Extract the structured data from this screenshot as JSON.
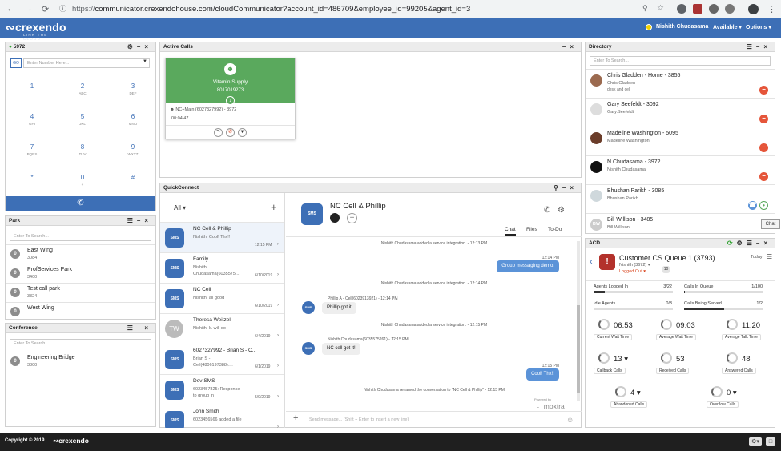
{
  "browser": {
    "url_scheme": "https://",
    "url": "communicator.crexendohouse.com/cloudCommunicator?account_id=486709&employee_id=99205&agent_id=3",
    "nav": [
      "←",
      "→",
      "⟳"
    ]
  },
  "header": {
    "logo": "crexendo",
    "logo_tagline": "LINK THE CLOUD",
    "user": "Nishith Chudasama",
    "availability": "Available ▾",
    "options": "Options ▾"
  },
  "dialer": {
    "title": "5972",
    "go_label": "GO",
    "input_placeholder": "Enter Number Here...",
    "keys": [
      {
        "d": "1",
        "l": ""
      },
      {
        "d": "2",
        "l": "ABC"
      },
      {
        "d": "3",
        "l": "DEF"
      },
      {
        "d": "4",
        "l": "GHI"
      },
      {
        "d": "5",
        "l": "JKL"
      },
      {
        "d": "6",
        "l": "MNO"
      },
      {
        "d": "7",
        "l": "PQRS"
      },
      {
        "d": "8",
        "l": "TUV"
      },
      {
        "d": "9",
        "l": "WXYZ"
      },
      {
        "d": "*",
        "l": ""
      },
      {
        "d": "0",
        "l": "+"
      },
      {
        "d": "#",
        "l": ""
      }
    ]
  },
  "park": {
    "title": "Park",
    "search_placeholder": "Enter To Search...",
    "items": [
      {
        "name": "East Wing",
        "num": "3084"
      },
      {
        "name": "ProfServices Park",
        "num": "3400"
      },
      {
        "name": "Test call park",
        "num": "3324"
      },
      {
        "name": "West Wing",
        "num": ""
      }
    ]
  },
  "conference": {
    "title": "Conference",
    "search_placeholder": "Enter To Search...",
    "items": [
      {
        "name": "Engineering Bridge",
        "num": "3800"
      }
    ]
  },
  "active_calls": {
    "title": "Active Calls",
    "card": {
      "name": "Vitamin Supply",
      "number": "8017019273",
      "line": "NC+Main (6027327992) - 3972",
      "duration": "00:04:47"
    }
  },
  "quickconnect": {
    "title": "QuickConnect",
    "filter": "All",
    "conversations": [
      {
        "name": "NC Cell & Phillip",
        "preview": "Nishith: Cool! Thx!!",
        "date": "12:15 PM"
      },
      {
        "name": "Family",
        "preview": "Nishith Chudasama(6035575...",
        "date": "6/10/2019"
      },
      {
        "name": "NC Cell",
        "preview": "Nishith: all good",
        "date": "6/10/2019"
      },
      {
        "name": "Theresa Weitzel",
        "preview": "Nishith: k. will do",
        "date": "6/4/2019"
      },
      {
        "name": "6027327992 - Brian S - C...",
        "preview": "Brian S - Cell(4806197388):...",
        "date": "6/1/2019"
      },
      {
        "name": "Dev SMS",
        "preview": "6023457825: Response to group in",
        "date": "5/9/2019"
      },
      {
        "name": "John Smith",
        "preview": "6023456566 added a file",
        "date": ""
      }
    ],
    "chat": {
      "title": "NC Cell & Phillip",
      "tabs": [
        "Chat",
        "Files",
        "To-Do"
      ],
      "messages": [
        {
          "kind": "sys",
          "text": "Nishith Chudasama added a service integration. - 12:13 PM"
        },
        {
          "kind": "out",
          "time": "12:14 PM",
          "text": "Group messaging demo."
        },
        {
          "kind": "sys",
          "text": "Nishith Chudasama added a service integration. - 12:14 PM"
        },
        {
          "kind": "in",
          "meta": "Phillip A - Cell(6023913921) - 12:14 PM",
          "text": "Phillip got it"
        },
        {
          "kind": "sys",
          "text": "Nishith Chudasama added a service integration. - 12:15 PM"
        },
        {
          "kind": "in",
          "meta": "Nishith Chudasama(6035575261) - 12:15 PM",
          "text": "NC cell got it!"
        },
        {
          "kind": "out",
          "time": "12:15 PM",
          "text": "Cool! Thx!!"
        },
        {
          "kind": "sys",
          "text": "Nishith Chudasama renamed the conversation to \"NC Cell & Phillip\" - 12:15 PM"
        }
      ],
      "powered": "Powered by",
      "brand": "moxtra",
      "composer_placeholder": "Send message... (Shift + Enter to insert a new line)"
    }
  },
  "directory": {
    "title": "Directory",
    "search_placeholder": "Enter To Search...",
    "entries": [
      {
        "name": "Chris Gladden - Home - 3855",
        "sub": "Chris Gladden",
        "sub2": "desk and cell"
      },
      {
        "name": "Gary Seefeldt - 3092",
        "sub": "Gary.Seefeldt",
        "sub2": ""
      },
      {
        "name": "Madeline Washington - 5095",
        "sub": "Madeline Washington",
        "sub2": ""
      },
      {
        "name": "N Chudasama - 3972",
        "sub": "Nishith Chudasama",
        "sub2": ""
      },
      {
        "name": "Bhushan Parikh - 3085",
        "sub": "Bhushan Parikh",
        "sub2": ""
      },
      {
        "name": "Bill Willison - 3485",
        "sub": "Bill Willison",
        "sub2": ""
      }
    ],
    "bill_initials": "BW",
    "tooltip": "Chat"
  },
  "acd": {
    "title": "ACD",
    "queue_name": "Customer CS Queue 1 (3793)",
    "agent": "Nishith (3672) ▾",
    "status": "Logged Out ▾",
    "count": "10",
    "period": "Today",
    "metrics": [
      {
        "label": "Agents Logged In",
        "value": "3/22"
      },
      {
        "label": "Calls In Queue",
        "value": "1/100"
      },
      {
        "label": "Idle Agents",
        "value": "0/3"
      },
      {
        "label": "Calls Being Served",
        "value": "1/2"
      }
    ],
    "stats": [
      {
        "value": "06:53",
        "label": "Current Wait Time"
      },
      {
        "value": "09:03",
        "label": "Average Wait Time"
      },
      {
        "value": "11:20",
        "label": "Average Talk Time"
      },
      {
        "value": "13 ▾",
        "label": "Callback Calls"
      },
      {
        "value": "53",
        "label": "Received Calls"
      },
      {
        "value": "48",
        "label": "Answered Calls"
      },
      {
        "value": "4 ▾",
        "label": "Abandoned Calls"
      },
      {
        "value": "0 ▾",
        "label": "Overflow Calls"
      }
    ]
  },
  "footer": {
    "copyright": "Copyright © 2019",
    "brand": "crexendo"
  }
}
